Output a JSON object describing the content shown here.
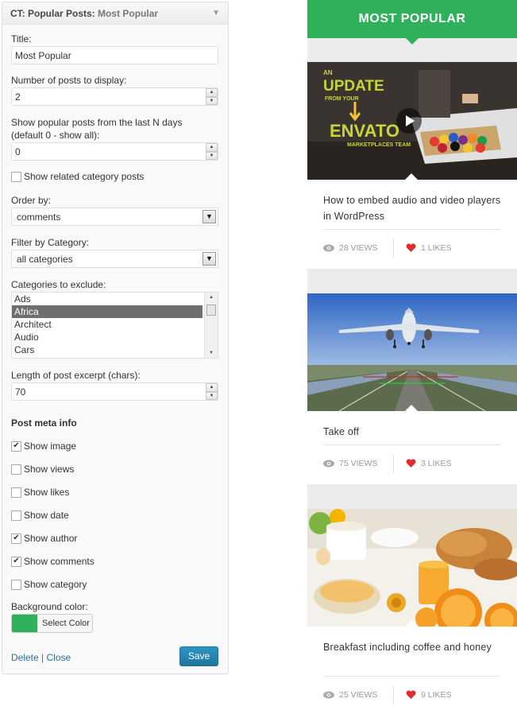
{
  "widget": {
    "title": "CT: Popular Posts:",
    "subtitle": "Most Popular",
    "fields": {
      "title_label": "Title:",
      "title_value": "Most Popular",
      "num_posts_label": "Number of posts to display:",
      "num_posts_value": "2",
      "days_label_1": "Show popular posts from the last N days",
      "days_label_2": "(default 0 - show all):",
      "days_value": "0",
      "related_label": "Show related category posts",
      "order_label": "Order by:",
      "order_value": "comments",
      "filter_label": "Filter by Category:",
      "filter_value": "all categories",
      "exclude_label": "Categories to exclude:",
      "exclude_options": [
        "Ads",
        "Africa",
        "Architect",
        "Audio",
        "Cars"
      ],
      "exclude_selected": "Africa",
      "excerpt_label": "Length of post excerpt (chars):",
      "excerpt_value": "70"
    },
    "meta": {
      "section_title": "Post meta info",
      "show_image": "Show image",
      "show_views": "Show views",
      "show_likes": "Show likes",
      "show_date": "Show date",
      "show_author": "Show author",
      "show_comments": "Show comments",
      "show_category": "Show category",
      "checked": {
        "show_image": true,
        "show_views": false,
        "show_likes": false,
        "show_date": false,
        "show_author": true,
        "show_comments": true,
        "show_category": false,
        "related": false
      }
    },
    "bg_color_label": "Background color:",
    "select_color_label": "Select Color",
    "bg_color_value": "#2eb15a",
    "delete_label": "Delete",
    "link_sep": "|",
    "close_label": "Close",
    "save_label": "Save"
  },
  "preview": {
    "header": "MOST POPULAR",
    "posts": [
      {
        "title": "How to embed audio and video players in WordPress",
        "views": "28 VIEWS",
        "likes": "1 LIKES",
        "image_text_1": "AN",
        "image_text_2": "UPDATE",
        "image_text_3": "FROM YOUR",
        "image_text_4": "ENVATO",
        "image_text_5": "MARKETPLACES TEAM"
      },
      {
        "title": "Take off",
        "views": "75 VIEWS",
        "likes": "3 LIKES"
      },
      {
        "title": "Breakfast including coffee and honey",
        "views": "25 VIEWS",
        "likes": "9 LIKES"
      }
    ]
  },
  "colors": {
    "accent_green": "#2eb15a",
    "link_blue": "#21759b",
    "heart_red": "#e32b2b"
  }
}
